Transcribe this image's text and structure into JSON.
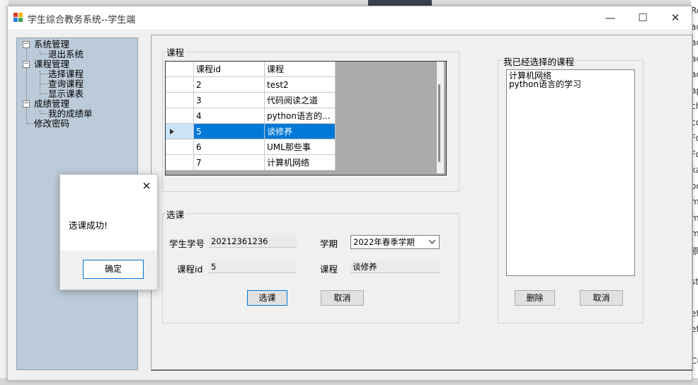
{
  "window": {
    "title": "学生综合教务系统--学生端",
    "controls": {
      "minimize": "—",
      "maximize": "☐",
      "close": "✕"
    }
  },
  "tree": {
    "nodes": [
      {
        "label": "系统管理",
        "expander": "−",
        "children": [
          "退出系统"
        ]
      },
      {
        "label": "课程管理",
        "expander": "−",
        "children": [
          "选择课程",
          "查询课程",
          "显示课表"
        ]
      },
      {
        "label": "成绩管理",
        "expander": "−",
        "children": [
          "我的成绩单"
        ]
      },
      {
        "label": "修改密码"
      }
    ]
  },
  "courses": {
    "group_label": "课程",
    "columns": [
      "课程id",
      "课程"
    ],
    "rows": [
      {
        "id": "2",
        "name": "test2"
      },
      {
        "id": "3",
        "name": "代码阅读之道"
      },
      {
        "id": "4",
        "name": "python语言的..."
      },
      {
        "id": "5",
        "name": "谈修养",
        "selected": true
      },
      {
        "id": "6",
        "name": "UML那些事"
      },
      {
        "id": "7",
        "name": "计算机网络"
      }
    ]
  },
  "selection": {
    "group_label": "选课",
    "student_id_label": "学生学号",
    "student_id_value": "20212361236",
    "term_label": "学期",
    "term_value": "2022年春季学期",
    "course_id_label": "课程id",
    "course_id_value": "5",
    "course_label": "课程",
    "course_value": "谈修养",
    "select_button": "选课",
    "cancel_button": "取消"
  },
  "chosen": {
    "group_label": "我已经选择的课程",
    "items": [
      "计算机网络",
      "python语言的学习"
    ],
    "delete_button": "删除",
    "cancel_button": "取消"
  },
  "dialog": {
    "message": "选课成功!",
    "ok_button": "确定",
    "close": "✕"
  },
  "background_right_text": [
    "Re",
    "ac",
    "ac",
    "ac",
    "ac",
    "ap",
    "ch",
    "co",
    "Fo",
    "Fo",
    "ka",
    "oo",
    "m",
    "m",
    "m",
    "原",
    "",
    "st",
    "",
    "ef",
    "ef",
    "",
    "Cu"
  ]
}
